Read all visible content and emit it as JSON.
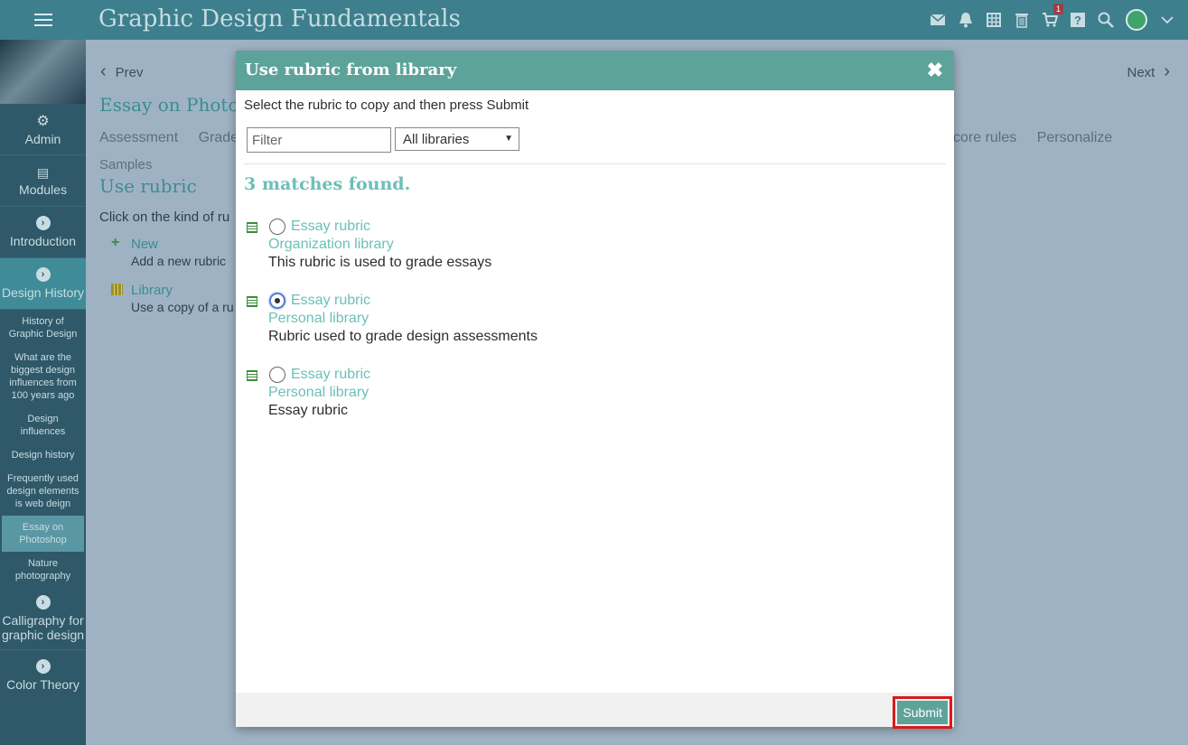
{
  "app": {
    "title": "Graphic Design Fundamentals",
    "cart_count": "1"
  },
  "sidebar": {
    "main_items": [
      {
        "label": "Admin"
      },
      {
        "label": "Modules"
      },
      {
        "label": "Introduction"
      },
      {
        "label": "Design History"
      },
      {
        "label": "Calligraphy for graphic design"
      },
      {
        "label": "Color Theory"
      }
    ],
    "sub_items": [
      {
        "label": "History of Graphic Design"
      },
      {
        "label": "What are the biggest design influences from 100 years ago"
      },
      {
        "label": "Design influences"
      },
      {
        "label": "Design history"
      },
      {
        "label": "Frequently used design elements is web deign"
      },
      {
        "label": "Essay on Photoshop"
      },
      {
        "label": "Nature photography"
      }
    ]
  },
  "content": {
    "prev": "Prev",
    "next": "Next",
    "title": "Essay on Photo",
    "tabs": [
      "Assessment",
      "Grade"
    ],
    "tabs_right": [
      "core rules",
      "Personalize"
    ],
    "samples": "Samples",
    "use_rubric": "Use rubric",
    "click_on": "Click on the kind of ru",
    "options": [
      {
        "label": "New",
        "desc": "Add a new rubric"
      },
      {
        "label": "Library",
        "desc": "Use a copy of a ru"
      }
    ]
  },
  "modal": {
    "title": "Use rubric from library",
    "close": "✖",
    "instructions": "Select the rubric to copy and then press Submit",
    "filter_placeholder": "Filter",
    "library_select": "All libraries",
    "matches": "3 matches found.",
    "results": [
      {
        "name": "Essay rubric",
        "library": "Organization library",
        "desc": "This rubric is used to grade essays",
        "checked": false
      },
      {
        "name": "Essay rubric",
        "library": "Personal library",
        "desc": "Rubric used to grade design assessments",
        "checked": true
      },
      {
        "name": "Essay rubric",
        "library": "Personal library",
        "desc": "Essay rubric",
        "checked": false
      }
    ],
    "submit": "Submit"
  },
  "colors": {
    "topbar": "#3d7f8c",
    "modal_header": "#5ea39a",
    "accent_teal": "#6cc0b7",
    "highlight_red": "#d61b1b"
  }
}
